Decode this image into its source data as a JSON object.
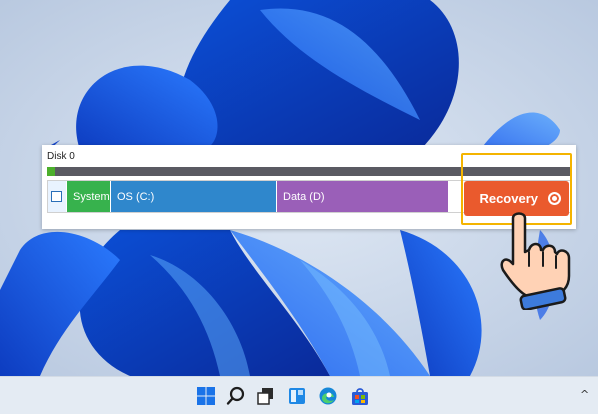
{
  "disk": {
    "label": "Disk 0",
    "usage_fraction": 0.015,
    "partitions": [
      {
        "label": "System",
        "color": "#37b24d"
      },
      {
        "label": "OS (C:)",
        "color": "#2f87cc"
      },
      {
        "label": "Data (D)",
        "color": "#9a5fb8"
      },
      {
        "label": "Recovery",
        "color": "#ea5a2d"
      }
    ]
  },
  "highlight_color": "#f4b400",
  "taskbar": {
    "icons": [
      "windows-start-icon",
      "search-icon",
      "task-view-icon",
      "widgets-icon",
      "edge-icon",
      "store-icon"
    ],
    "tray_chevron": "^"
  }
}
